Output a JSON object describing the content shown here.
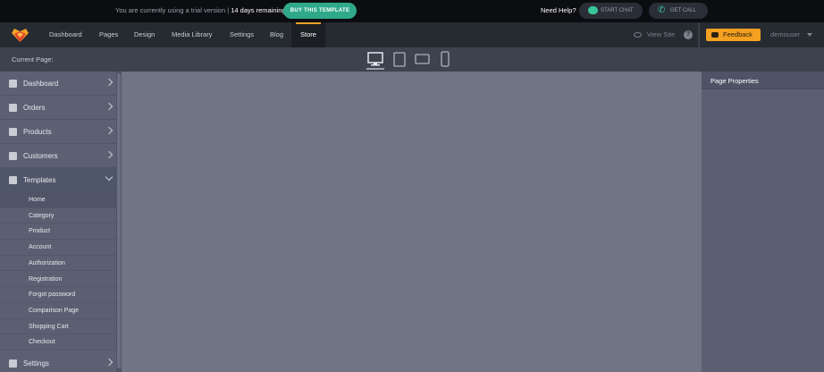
{
  "trial": {
    "message": "You are currently using a trial version | ",
    "days_remaining": "14 days remaining:",
    "buy_button": "BUY THIS TEMPLATE",
    "need_help": "Need Help?",
    "chat_button": "START CHAT",
    "call_button": "GET CALL"
  },
  "nav": {
    "items": [
      "Dashboard",
      "Pages",
      "Design",
      "Media Library",
      "Settings",
      "Blog",
      "Store"
    ],
    "active": "Store",
    "view_site": "View Site",
    "help": "?",
    "feedback": "Feedback",
    "user": "demouser"
  },
  "toolbar": {
    "current_page_label": "Current Page:",
    "devices": [
      "desktop-icon",
      "tablet-icon",
      "tablet-landscape-icon",
      "mobile-icon"
    ],
    "active_device": "desktop-icon"
  },
  "sidebar": {
    "items": [
      {
        "label": "Dashboard",
        "icon": "dashboard-icon"
      },
      {
        "label": "Orders",
        "icon": "orders-icon"
      },
      {
        "label": "Products",
        "icon": "cart-icon"
      },
      {
        "label": "Customers",
        "icon": "users-icon"
      },
      {
        "label": "Templates",
        "icon": "templates-icon",
        "expanded": true
      },
      {
        "label": "Settings",
        "icon": "gear-icon"
      }
    ],
    "template_pages": [
      "Home",
      "Category",
      "Product",
      "Account",
      "Authorization",
      "Registration",
      "Forgot password",
      "Comparison Page",
      "Shopping Cart",
      "Checkout"
    ],
    "active_page": "Home"
  },
  "right_panel": {
    "title": "Page Properties"
  },
  "colors": {
    "accent": "#f0a126",
    "primary_button": "#2fa98a",
    "feedback": "#f4a020"
  }
}
